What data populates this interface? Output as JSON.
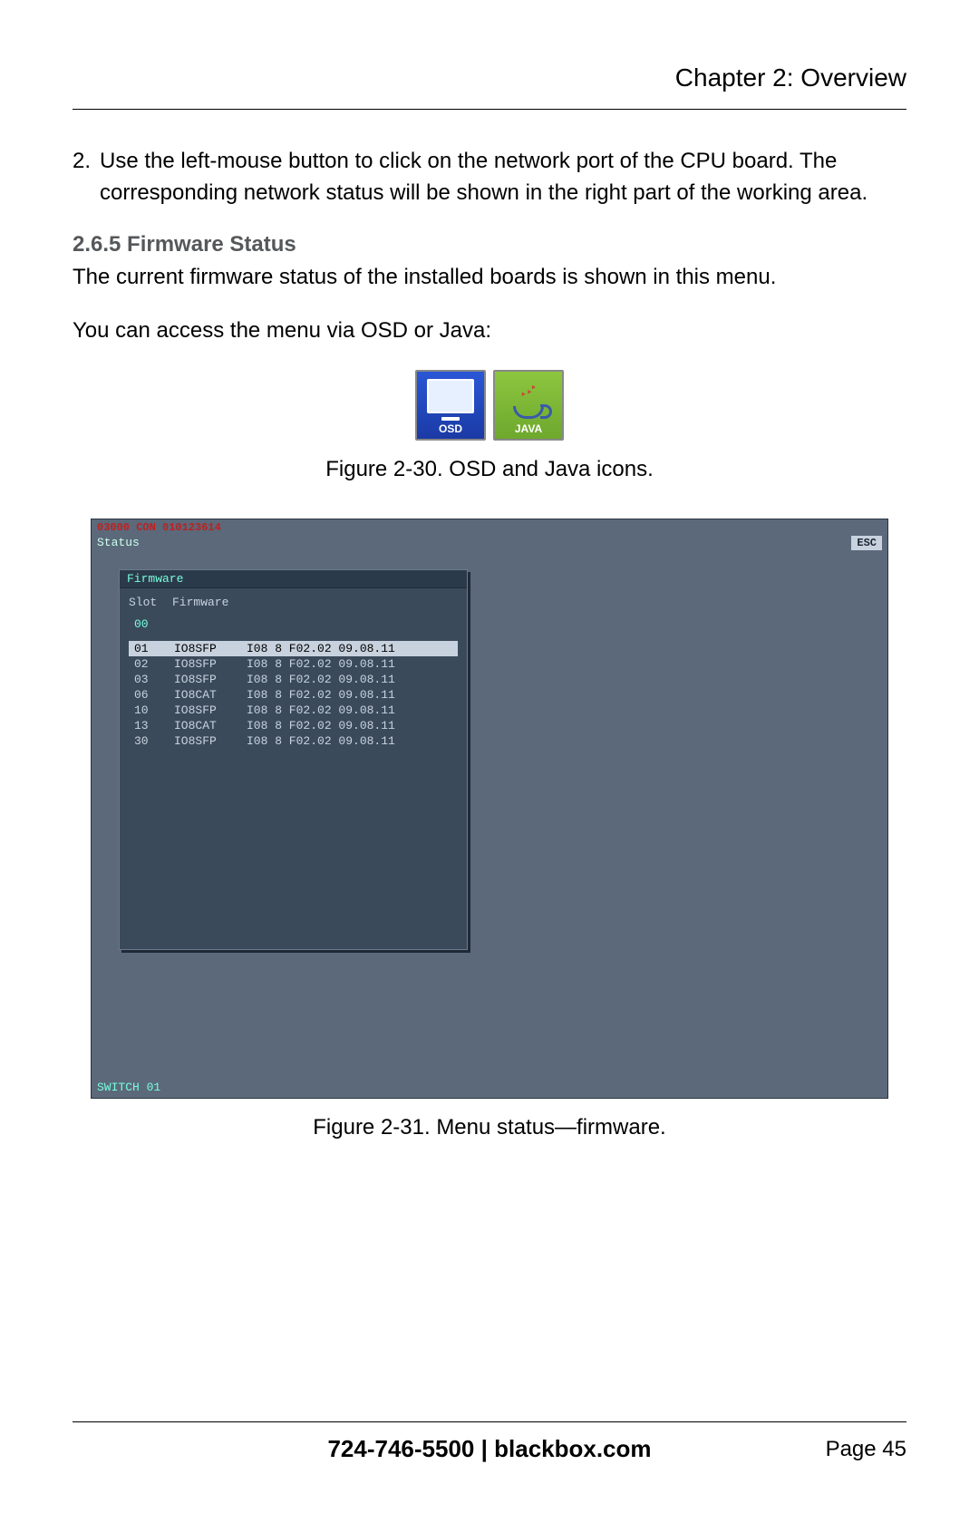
{
  "header": {
    "chapter": "Chapter 2: Overview"
  },
  "step": {
    "num": "2.",
    "text": "Use the left-mouse button to click on the network port of the CPU board. The corresponding network status will be shown in the right part of the working area."
  },
  "subheading": "2.6.5 Firmware Status",
  "para1": "The current firmware status of the installed boards is shown in this menu.",
  "para2": "You can access the menu via OSD or Java:",
  "icons": {
    "osd": "OSD",
    "java": "JAVA"
  },
  "fig30": "Figure 2-30. OSD and Java icons.",
  "screenshot": {
    "top": "03000 CON 010123614",
    "status": "Status",
    "esc": "ESC",
    "panel_title": "Firmware",
    "col_slot": "Slot",
    "col_fw": "Firmware",
    "row0": {
      "slot": "00",
      "name": "",
      "fw": ""
    },
    "rows": [
      {
        "slot": "01",
        "name": "IO8SFP",
        "fw": "I08 8 F02.02 09.08.11",
        "selected": true
      },
      {
        "slot": "02",
        "name": "IO8SFP",
        "fw": "I08 8 F02.02 09.08.11",
        "selected": false
      },
      {
        "slot": "03",
        "name": "IO8SFP",
        "fw": "I08 8 F02.02 09.08.11",
        "selected": false
      },
      {
        "slot": "06",
        "name": "IO8CAT",
        "fw": "I08 8 F02.02 09.08.11",
        "selected": false
      },
      {
        "slot": "10",
        "name": "IO8SFP",
        "fw": "I08 8 F02.02 09.08.11",
        "selected": false
      },
      {
        "slot": "13",
        "name": "IO8CAT",
        "fw": "I08 8 F02.02 09.08.11",
        "selected": false
      },
      {
        "slot": "30",
        "name": "IO8SFP",
        "fw": "I08 8 F02.02 09.08.11",
        "selected": false
      }
    ],
    "switch": "SWITCH 01"
  },
  "fig31": "Figure 2-31. Menu status—firmware.",
  "footer": {
    "phone": "724-746-5500",
    "sep": "   |   ",
    "site": "blackbox.com",
    "page": "Page 45"
  }
}
